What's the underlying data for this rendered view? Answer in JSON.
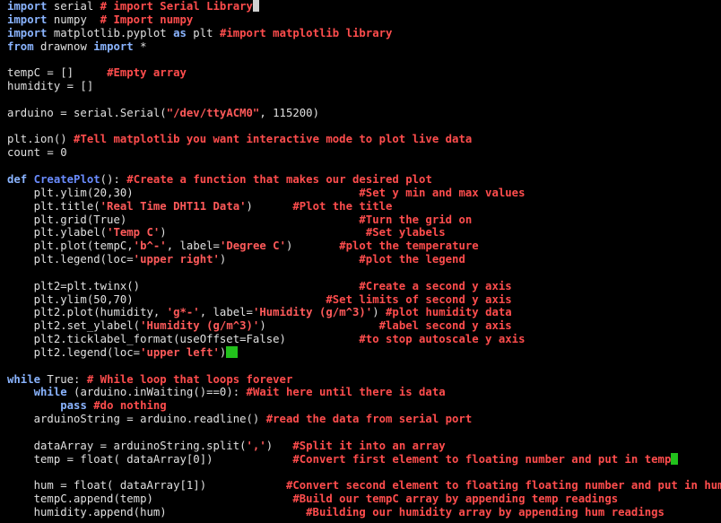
{
  "editor": {
    "language": "python",
    "colors": {
      "background": "#000000",
      "keyword": "#8ab4ff",
      "function_name": "#6a8cff",
      "string": "#ff5a5a",
      "comment": "#ff4d4d",
      "plain": "#e0e0e0",
      "cursor_marker": "#22c11c"
    },
    "lines": [
      [
        [
          "kw",
          "import"
        ],
        [
          "pl",
          " serial "
        ],
        [
          "cm",
          "# import Serial Library"
        ],
        [
          "cursor-white",
          ""
        ]
      ],
      [
        [
          "kw",
          "import"
        ],
        [
          "pl",
          " numpy  "
        ],
        [
          "cm",
          "# Import numpy"
        ]
      ],
      [
        [
          "kw",
          "import"
        ],
        [
          "pl",
          " matplotlib.pyplot "
        ],
        [
          "kw",
          "as"
        ],
        [
          "pl",
          " plt "
        ],
        [
          "cm",
          "#import matplotlib library"
        ]
      ],
      [
        [
          "kw",
          "from"
        ],
        [
          "pl",
          " drawnow "
        ],
        [
          "kw",
          "import"
        ],
        [
          "pl",
          " *"
        ]
      ],
      [
        [
          "pl",
          ""
        ]
      ],
      [
        [
          "pl",
          "tempC = []     "
        ],
        [
          "cm",
          "#Empty array"
        ]
      ],
      [
        [
          "pl",
          "humidity = []"
        ]
      ],
      [
        [
          "pl",
          ""
        ]
      ],
      [
        [
          "pl",
          "arduino = serial.Serial("
        ],
        [
          "str",
          "\"/dev/ttyACM0\""
        ],
        [
          "pl",
          ", 115200)"
        ]
      ],
      [
        [
          "pl",
          ""
        ]
      ],
      [
        [
          "pl",
          "plt.ion() "
        ],
        [
          "cm",
          "#Tell matplotlib you want interactive mode to plot live data"
        ]
      ],
      [
        [
          "pl",
          "count = 0"
        ]
      ],
      [
        [
          "pl",
          ""
        ]
      ],
      [
        [
          "kw",
          "def"
        ],
        [
          "pl",
          " "
        ],
        [
          "fn",
          "CreatePlot"
        ],
        [
          "pl",
          "(): "
        ],
        [
          "cm",
          "#Create a function that makes our desired plot"
        ]
      ],
      [
        [
          "pl",
          "    plt.ylim(20,30)                                  "
        ],
        [
          "cm",
          "#Set y min and max values"
        ]
      ],
      [
        [
          "pl",
          "    plt.title("
        ],
        [
          "str",
          "'Real Time DHT11 Data'"
        ],
        [
          "pl",
          ")      "
        ],
        [
          "cm",
          "#Plot the title"
        ]
      ],
      [
        [
          "pl",
          "    plt.grid(True)                                   "
        ],
        [
          "cm",
          "#Turn the grid on"
        ]
      ],
      [
        [
          "pl",
          "    plt.ylabel("
        ],
        [
          "str",
          "'Temp C'"
        ],
        [
          "pl",
          ")                              "
        ],
        [
          "cm",
          "#Set ylabels"
        ]
      ],
      [
        [
          "pl",
          "    plt.plot(tempC,"
        ],
        [
          "str",
          "'b^-'"
        ],
        [
          "pl",
          ", label="
        ],
        [
          "str",
          "'Degree C'"
        ],
        [
          "pl",
          ")       "
        ],
        [
          "cm",
          "#plot the temperature"
        ]
      ],
      [
        [
          "pl",
          "    plt.legend(loc="
        ],
        [
          "str",
          "'upper right'"
        ],
        [
          "pl",
          ")                    "
        ],
        [
          "cm",
          "#plot the legend"
        ]
      ],
      [
        [
          "pl",
          ""
        ]
      ],
      [
        [
          "pl",
          "    plt2=plt.twinx()                                 "
        ],
        [
          "cm",
          "#Create a second y axis"
        ]
      ],
      [
        [
          "pl",
          "    plt.ylim(50,70)                             "
        ],
        [
          "cm",
          "#Set limits of second y axis"
        ]
      ],
      [
        [
          "pl",
          "    plt2.plot(humidity, "
        ],
        [
          "str",
          "'g*-'"
        ],
        [
          "pl",
          ", label="
        ],
        [
          "str",
          "'Humidity (g/m^3)'"
        ],
        [
          "pl",
          ") "
        ],
        [
          "cm",
          "#plot humidity data"
        ]
      ],
      [
        [
          "pl",
          "    plt2.set_ylabel("
        ],
        [
          "str",
          "'Humidity (g/m^3)'"
        ],
        [
          "pl",
          ")                 "
        ],
        [
          "cm",
          "#label second y axis"
        ]
      ],
      [
        [
          "pl",
          "    plt2.ticklabel_format(useOffset=False)           "
        ],
        [
          "cm",
          "#to stop autoscale y axis"
        ]
      ],
      [
        [
          "pl",
          "    plt2.legend(loc="
        ],
        [
          "str",
          "'upper left'"
        ],
        [
          "pl",
          ")"
        ],
        [
          "cursor-green",
          ""
        ]
      ],
      [
        [
          "pl",
          ""
        ]
      ],
      [
        [
          "kw",
          "while"
        ],
        [
          "pl",
          " True: "
        ],
        [
          "cm",
          "# While loop that loops forever"
        ]
      ],
      [
        [
          "pl",
          "    "
        ],
        [
          "kw",
          "while"
        ],
        [
          "pl",
          " (arduino.inWaiting()==0): "
        ],
        [
          "cm",
          "#Wait here until there is data"
        ]
      ],
      [
        [
          "pl",
          "        "
        ],
        [
          "kw",
          "pass"
        ],
        [
          "pl",
          " "
        ],
        [
          "cm",
          "#do nothing"
        ]
      ],
      [
        [
          "pl",
          "    arduinoString = arduino.readline() "
        ],
        [
          "cm",
          "#read the data from serial port"
        ]
      ],
      [
        [
          "pl",
          ""
        ]
      ],
      [
        [
          "pl",
          "    dataArray = arduinoString.split("
        ],
        [
          "str",
          "','"
        ],
        [
          "pl",
          ")   "
        ],
        [
          "cm",
          "#Split it into an array"
        ]
      ],
      [
        [
          "pl",
          "    temp = float( dataArray[0])            "
        ],
        [
          "cm",
          "#Convert first element to floating number and put in temp"
        ],
        [
          "cursor-green-thin",
          ""
        ]
      ],
      [
        [
          "pl",
          ""
        ]
      ],
      [
        [
          "pl",
          "    hum = float( dataArray[1])            "
        ],
        [
          "cm",
          "#Convert second element to floating floating number and put in hum"
        ]
      ],
      [
        [
          "pl",
          "    tempC.append(temp)                     "
        ],
        [
          "cm",
          "#Build our tempC array by appending temp readings"
        ]
      ],
      [
        [
          "pl",
          "    humidity.append(hum)                     "
        ],
        [
          "cm",
          "#Building our humidity array by appending hum readings"
        ]
      ]
    ]
  }
}
